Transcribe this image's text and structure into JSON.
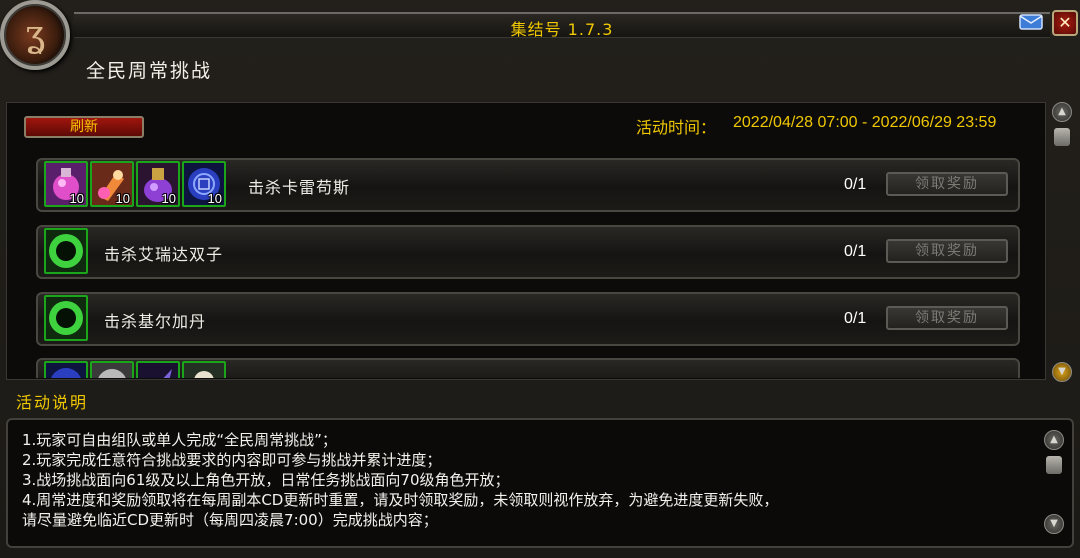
{
  "window": {
    "title": "集结号 1.7.3",
    "page_title": "全民周常挑战",
    "close_glyph": "✕"
  },
  "challenge": {
    "refresh_label": "刷新",
    "period_label": "活动时间：",
    "period_value": "2022/04/28 07:00 - 2022/06/29 23:59",
    "rows": [
      {
        "label": "击杀卡雷苟斯",
        "progress": "0/1",
        "claim_label": "领取奖励",
        "items": [
          {
            "icon": "pink-potion-icon",
            "count": "10"
          },
          {
            "icon": "orange-potion-icon",
            "count": "10"
          },
          {
            "icon": "purple-flask-icon",
            "count": "10"
          },
          {
            "icon": "blue-rune-icon",
            "count": "10"
          }
        ]
      },
      {
        "label": "击杀艾瑞达双子",
        "progress": "0/1",
        "claim_label": "领取奖励",
        "items": [
          {
            "icon": "green-ring-icon",
            "count": ""
          }
        ]
      },
      {
        "label": "击杀基尔加丹",
        "progress": "0/1",
        "claim_label": "领取奖励",
        "items": [
          {
            "icon": "green-ring-icon",
            "count": ""
          }
        ]
      },
      {
        "label": "",
        "progress": "",
        "claim_label": "",
        "items": [
          {
            "icon": "blue-rune-icon",
            "count": ""
          },
          {
            "icon": "grey-stone-icon",
            "count": ""
          },
          {
            "icon": "purple-feather-icon",
            "count": ""
          },
          {
            "icon": "white-herb-icon",
            "count": ""
          }
        ]
      }
    ]
  },
  "description": {
    "title": "活动说明",
    "lines": [
      "1.玩家可自由组队或单人完成“全民周常挑战”；",
      "2.玩家完成任意符合挑战要求的内容即可参与挑战并累计进度；",
      "3.战场挑战面向61级及以上角色开放，日常任务挑战面向70级角色开放；",
      "4.周常进度和奖励领取将在每周副本CD更新时重置，请及时领取奖励，未领取则视作放弃，为避免进度更新失败，",
      "请尽量避免临近CD更新时（每周四凌晨7:00）完成挑战内容；"
    ]
  },
  "colors": {
    "title_gold": "#f0c800",
    "item_border_green": "#1aa51a",
    "refresh_red": "#a0160e"
  }
}
